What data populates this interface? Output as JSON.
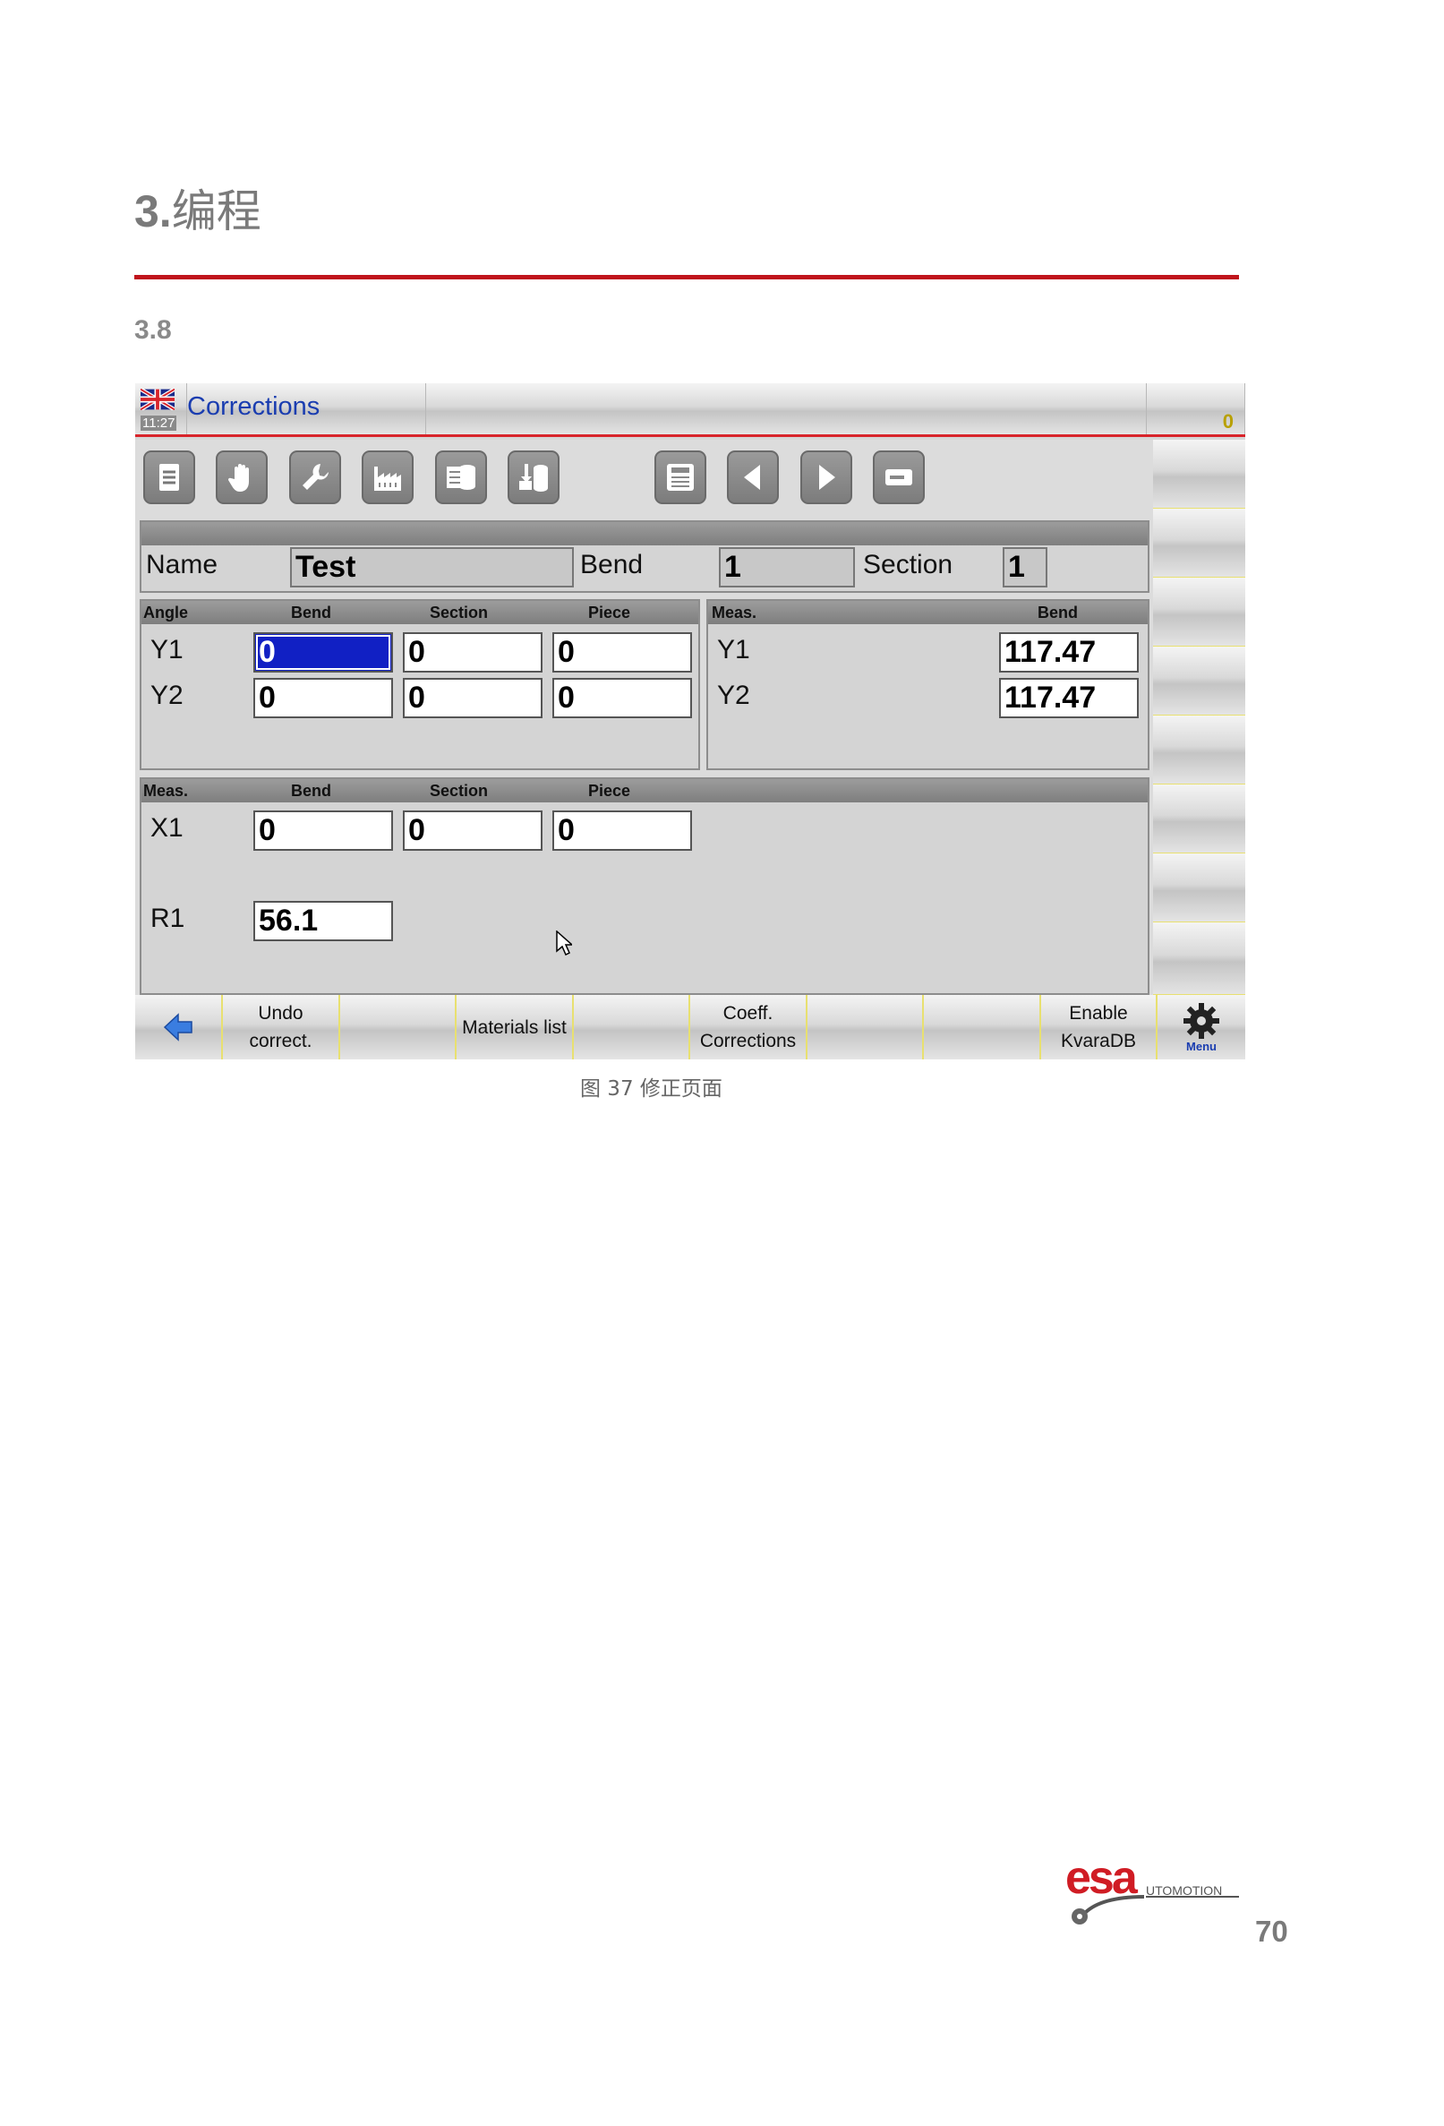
{
  "document": {
    "chapter_num": "3.",
    "chapter_title": "编程",
    "section": "3.8",
    "caption": "图 37 修正页面",
    "page_number": "70",
    "accent_color": "#c0141c"
  },
  "ui": {
    "time": "11:27",
    "window_title": "Corrections",
    "counter": "0",
    "toolbar_icons": [
      "document-icon",
      "hand-icon",
      "wrench-icon",
      "factory-icon",
      "database-icon",
      "database-import-icon",
      "save-icon",
      "previous-icon",
      "next-icon",
      "minus-icon"
    ],
    "header_row": {
      "name_label": "Name",
      "name_value": "Test",
      "bend_label": "Bend",
      "bend_value": "1",
      "section_label": "Section",
      "section_value": "1"
    },
    "angle_panel": {
      "head": "Angle",
      "col_bend": "Bend",
      "col_section": "Section",
      "col_piece": "Piece",
      "rows": [
        {
          "label": "Y1",
          "bend": "0",
          "section": "0",
          "piece": "0"
        },
        {
          "label": "Y2",
          "bend": "0",
          "section": "0",
          "piece": "0"
        }
      ]
    },
    "meas_panel": {
      "head": "Meas.",
      "col_bend": "Bend",
      "rows": [
        {
          "label": "Y1",
          "bend": "117.47"
        },
        {
          "label": "Y2",
          "bend": "117.47"
        }
      ]
    },
    "x_panel": {
      "head": "Meas.",
      "col_bend": "Bend",
      "col_section": "Section",
      "col_piece": "Piece",
      "x1_label": "X1",
      "x1_bend": "0",
      "x1_section": "0",
      "x1_piece": "0",
      "r1_label": "R1",
      "r1_value": "56.1"
    },
    "fkeys": {
      "undo_line1": "Undo",
      "undo_line2": "correct.",
      "materials": "Materials list",
      "coeff_line1": "Coeff.",
      "coeff_line2": "Corrections",
      "enable_line1": "Enable",
      "enable_line2": "KvaraDB",
      "menu": "Menu"
    }
  }
}
